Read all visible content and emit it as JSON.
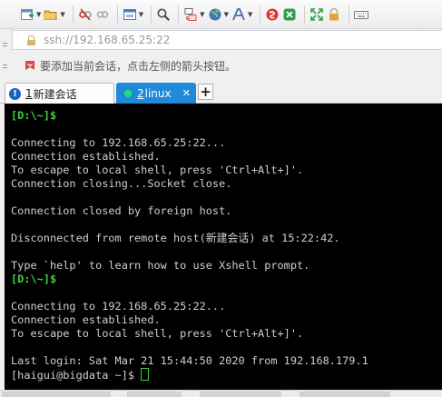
{
  "toolbar": {
    "buttons": [
      {
        "name": "new-session-icon",
        "color": "#2e9e4a"
      },
      {
        "name": "open-folder-icon",
        "color": "#e0a63a"
      },
      {
        "name": "disconnect-icon",
        "color": "#c0392b"
      },
      {
        "name": "reconnect-icon",
        "color": "#9e9e9e"
      },
      {
        "name": "new-tab-icon",
        "color": "#4a7fc1"
      },
      {
        "name": "search-icon",
        "color": "#4a4a4a"
      },
      {
        "name": "transfer-icon",
        "color": "#d9534f"
      },
      {
        "name": "globe-icon",
        "color": "#3a7ab8"
      },
      {
        "name": "font-icon",
        "color": "#4a6ea8"
      },
      {
        "name": "xftp-icon",
        "color": "#d8392b"
      },
      {
        "name": "xshell-icon",
        "color": "#2e9e4a"
      },
      {
        "name": "fullscreen-icon",
        "color": "#2e9e4a"
      },
      {
        "name": "lock-icon",
        "color": "#d08020"
      },
      {
        "name": "keyboard-icon",
        "color": "#777777"
      }
    ]
  },
  "address": {
    "text": "ssh://192.168.65.25:22"
  },
  "hint": {
    "text": "要添加当前会话，点击左侧的箭头按钮。"
  },
  "tabs": [
    {
      "number": "1",
      "label": "新建会话",
      "active": false
    },
    {
      "number": "2",
      "label": "linux",
      "active": true,
      "close": "✕"
    }
  ],
  "new_tab_label": "+",
  "terminal": {
    "lines": [
      {
        "text": "[D:\\~]$",
        "style": "green"
      },
      {
        "text": "",
        "style": ""
      },
      {
        "text": "Connecting to 192.168.65.25:22...",
        "style": ""
      },
      {
        "text": "Connection established.",
        "style": ""
      },
      {
        "text": "To escape to local shell, press 'Ctrl+Alt+]'.",
        "style": ""
      },
      {
        "text": "Connection closing...Socket close.",
        "style": ""
      },
      {
        "text": "",
        "style": ""
      },
      {
        "text": "Connection closed by foreign host.",
        "style": ""
      },
      {
        "text": "",
        "style": ""
      },
      {
        "text": "Disconnected from remote host(新建会话) at 15:22:42.",
        "style": ""
      },
      {
        "text": "",
        "style": ""
      },
      {
        "text": "Type `help' to learn how to use Xshell prompt.",
        "style": ""
      },
      {
        "text": "[D:\\~]$",
        "style": "green"
      },
      {
        "text": "",
        "style": ""
      },
      {
        "text": "Connecting to 192.168.65.25:22...",
        "style": ""
      },
      {
        "text": "Connection established.",
        "style": ""
      },
      {
        "text": "To escape to local shell, press 'Ctrl+Alt+]'.",
        "style": ""
      },
      {
        "text": "",
        "style": ""
      },
      {
        "text": "Last login: Sat Mar 21 15:44:50 2020 from 192.168.179.1",
        "style": ""
      }
    ],
    "prompt": "[haigui@bigdata ~]$ "
  }
}
